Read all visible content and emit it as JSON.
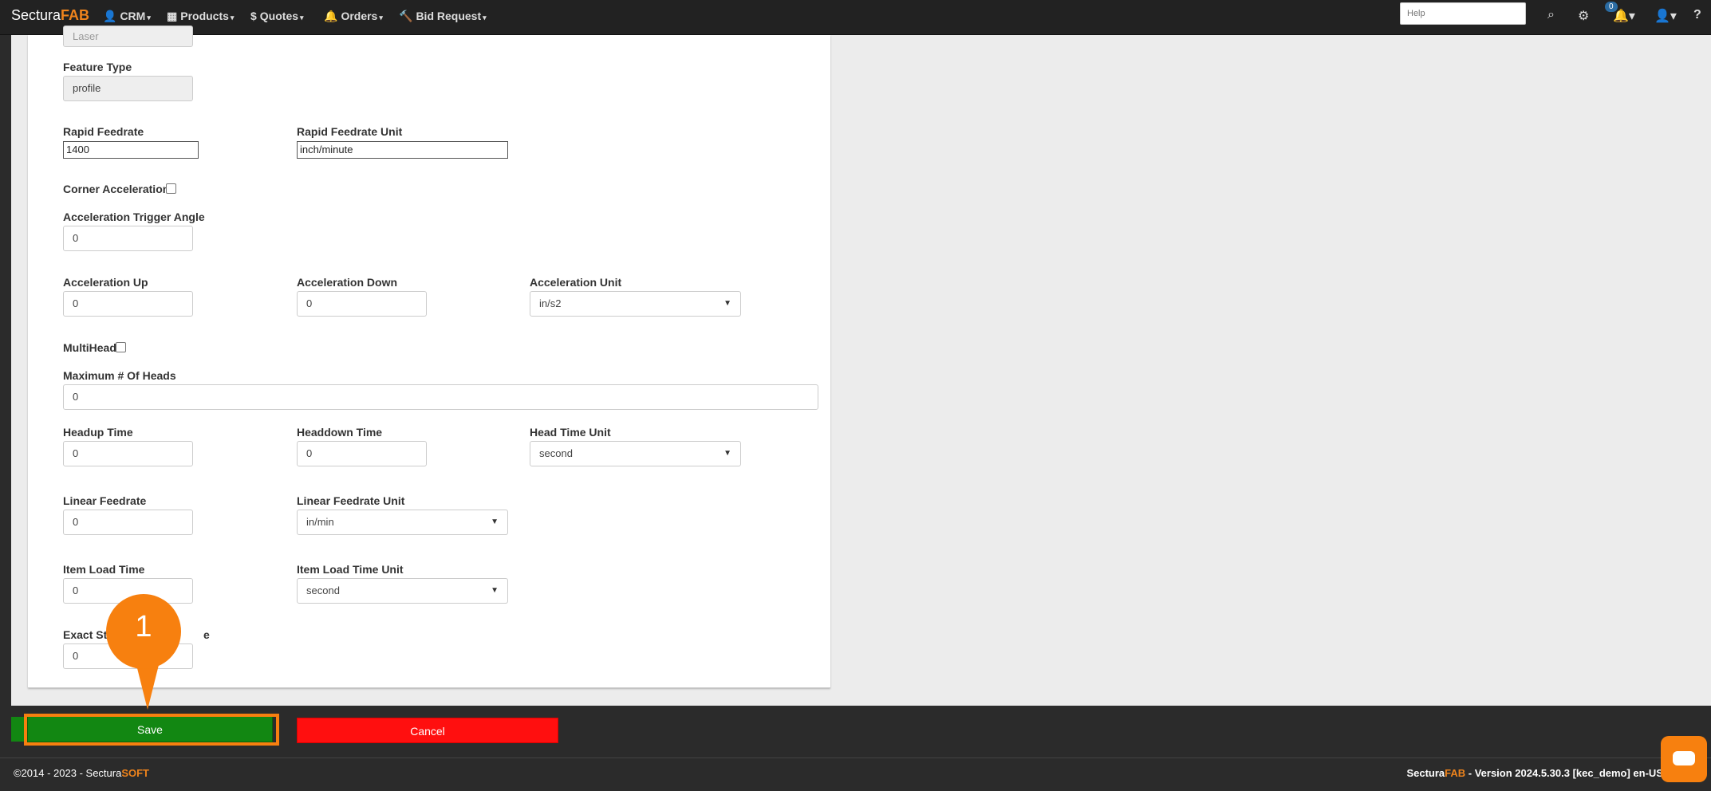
{
  "brand": {
    "part1": "Sectura",
    "part2": "FAB"
  },
  "nav": [
    {
      "icon": "👤",
      "label": "CRM"
    },
    {
      "icon": "▦",
      "label": "Products"
    },
    {
      "icon": "$",
      "label": "Quotes"
    },
    {
      "icon": "🔔",
      "label": "Orders"
    },
    {
      "icon": "🔨",
      "label": "Bid Request"
    }
  ],
  "help_placeholder": "Help",
  "notifications_count": "0",
  "form": {
    "process_value": "Laser",
    "feature_type_label": "Feature Type",
    "feature_type_value": "profile",
    "rapid_feedrate_label": "Rapid Feedrate",
    "rapid_feedrate_value": "1400",
    "rapid_feedrate_unit_label": "Rapid Feedrate Unit",
    "rapid_feedrate_unit_value": "inch/minute",
    "corner_acceleration_label": "Corner Acceleration",
    "accel_trigger_angle_label": "Acceleration Trigger Angle",
    "accel_trigger_angle_value": "0",
    "accel_up_label": "Acceleration Up",
    "accel_up_value": "0",
    "accel_down_label": "Acceleration Down",
    "accel_down_value": "0",
    "accel_unit_label": "Acceleration Unit",
    "accel_unit_value": "in/s2",
    "multihead_label": "MultiHead",
    "max_heads_label": "Maximum # Of Heads",
    "max_heads_value": "0",
    "headup_time_label": "Headup Time",
    "headup_time_value": "0",
    "headdown_time_label": "Headdown Time",
    "headdown_time_value": "0",
    "head_time_unit_label": "Head Time Unit",
    "head_time_unit_value": "second",
    "linear_feedrate_label": "Linear Feedrate",
    "linear_feedrate_value": "0",
    "linear_feedrate_unit_label": "Linear Feedrate Unit",
    "linear_feedrate_unit_value": "in/min",
    "item_load_time_label": "Item Load Time",
    "item_load_time_value": "0",
    "item_load_time_unit_label": "Item Load Time Unit",
    "item_load_time_unit_value": "second",
    "exact_stop_label_left": "Exact St",
    "exact_stop_label_right": "e",
    "exact_stop_value": "0"
  },
  "buttons": {
    "save": "Save",
    "cancel": "Cancel"
  },
  "marker_number": "1",
  "footer": {
    "copyright": "©2014 - 2023 - Sectura",
    "copyright_brand": "SOFT",
    "version_brand1": "Sectura",
    "version_brand2": "FAB",
    "version_text": " - Version 2024.5.30.3 [kec_demo] en-US"
  }
}
